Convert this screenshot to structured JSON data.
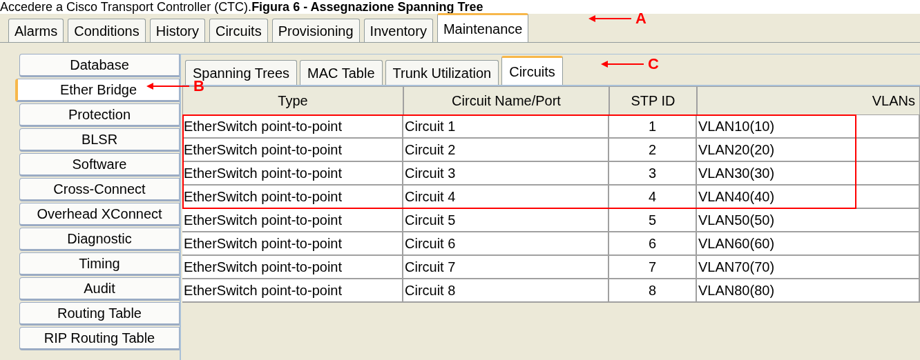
{
  "caption": "Accedere a Cisco Transport Controller (CTC).**Figura 6 - Assegnazione Spanning Tree**",
  "tabs": [
    {
      "label": "Alarms",
      "selected": false
    },
    {
      "label": "Conditions",
      "selected": false
    },
    {
      "label": "History",
      "selected": false
    },
    {
      "label": "Circuits",
      "selected": false
    },
    {
      "label": "Provisioning",
      "selected": false
    },
    {
      "label": "Inventory",
      "selected": false
    },
    {
      "label": "Maintenance",
      "selected": true
    }
  ],
  "side_items": [
    {
      "label": "Database",
      "selected": false
    },
    {
      "label": "Ether Bridge",
      "selected": true
    },
    {
      "label": "Protection",
      "selected": false
    },
    {
      "label": "BLSR",
      "selected": false
    },
    {
      "label": "Software",
      "selected": false
    },
    {
      "label": "Cross-Connect",
      "selected": false
    },
    {
      "label": "Overhead XConnect",
      "selected": false
    },
    {
      "label": "Diagnostic",
      "selected": false
    },
    {
      "label": "Timing",
      "selected": false
    },
    {
      "label": "Audit",
      "selected": false
    },
    {
      "label": "Routing Table",
      "selected": false
    },
    {
      "label": "RIP Routing Table",
      "selected": false
    }
  ],
  "subtabs": [
    {
      "label": "Spanning Trees",
      "selected": false
    },
    {
      "label": "MAC Table",
      "selected": false
    },
    {
      "label": "Trunk Utilization",
      "selected": false
    },
    {
      "label": "Circuits",
      "selected": true
    }
  ],
  "table": {
    "columns": [
      "Type",
      "Circuit Name/Port",
      "STP ID",
      "VLANs"
    ],
    "rows": [
      {
        "cells": [
          "EtherSwitch point-to-point",
          "Circuit 1",
          "1",
          "VLAN10(10)"
        ],
        "highlighted": true
      },
      {
        "cells": [
          "EtherSwitch point-to-point",
          "Circuit 2",
          "2",
          "VLAN20(20)"
        ],
        "highlighted": true
      },
      {
        "cells": [
          "EtherSwitch point-to-point",
          "Circuit 3",
          "3",
          "VLAN30(30)"
        ],
        "highlighted": true
      },
      {
        "cells": [
          "EtherSwitch point-to-point",
          "Circuit 4",
          "4",
          "VLAN40(40)"
        ],
        "highlighted": true
      },
      {
        "cells": [
          "EtherSwitch point-to-point",
          "Circuit 5",
          "5",
          "VLAN50(50)"
        ],
        "highlighted": false
      },
      {
        "cells": [
          "EtherSwitch point-to-point",
          "Circuit 6",
          "6",
          "VLAN60(60)"
        ],
        "highlighted": false
      },
      {
        "cells": [
          "EtherSwitch point-to-point",
          "Circuit 7",
          "7",
          "VLAN70(70)"
        ],
        "highlighted": false
      },
      {
        "cells": [
          "EtherSwitch point-to-point",
          "Circuit 8",
          "8",
          "VLAN80(80)"
        ],
        "highlighted": false
      }
    ]
  },
  "annotations": [
    {
      "label": "A"
    },
    {
      "label": "B"
    },
    {
      "label": "C"
    }
  ]
}
